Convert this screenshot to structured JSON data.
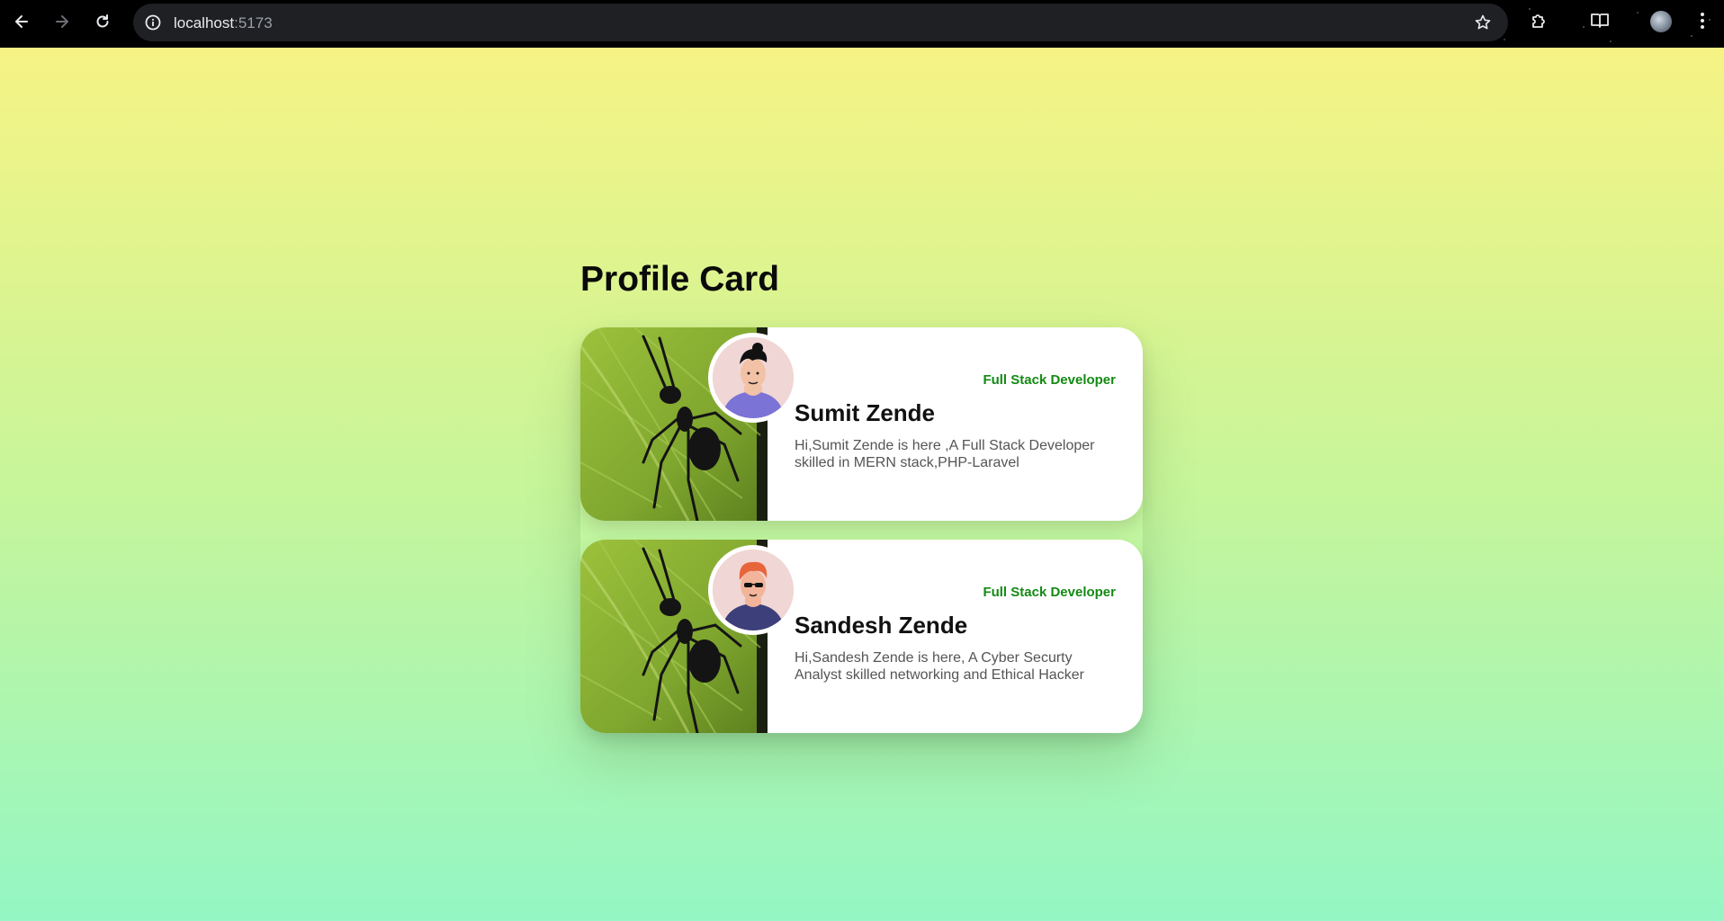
{
  "browser": {
    "url_host": "localhost",
    "url_port": ":5173"
  },
  "page": {
    "title": "Profile Card"
  },
  "cards": [
    {
      "role": "Full Stack Developer",
      "name": "Sumit Zende",
      "description": "Hi,Sumit Zende is here ,A Full Stack Developer skilled in MERN stack,PHP-Laravel"
    },
    {
      "role": "Full Stack Developer",
      "name": "Sandesh Zende",
      "description": "Hi,Sandesh Zende is here, A Cyber Securty Analyst skilled networking and Ethical Hacker"
    }
  ],
  "colors": {
    "role_text": "#138a13",
    "background_top": "#f6f384",
    "background_bottom": "#94f6c4"
  },
  "icons": {
    "back": "arrow-left-icon",
    "forward": "arrow-right-icon",
    "reload": "reload-icon",
    "site_info": "info-icon",
    "bookmark": "star-icon",
    "extensions": "puzzle-icon",
    "reading_list": "book-icon",
    "menu": "kebab-menu-icon"
  }
}
